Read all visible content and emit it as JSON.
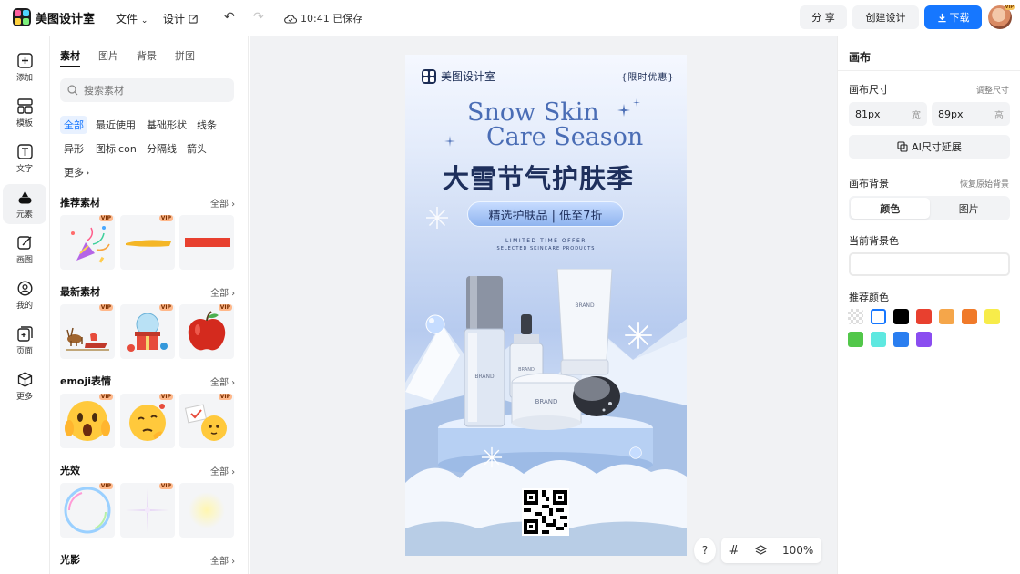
{
  "app": {
    "name": "美图设计室"
  },
  "menu": {
    "file": "文件",
    "design": "设计"
  },
  "save_status": "10:41 已保存",
  "actions": {
    "share": "分 享",
    "create": "创建设计",
    "download": "下载"
  },
  "user": {
    "badge": "VIP"
  },
  "rail": [
    {
      "label": "添加",
      "icon": "plus-square-icon"
    },
    {
      "label": "模板",
      "icon": "template-icon"
    },
    {
      "label": "文字",
      "icon": "text-icon"
    },
    {
      "label": "元素",
      "icon": "shapes-icon",
      "active": true
    },
    {
      "label": "画图",
      "icon": "pen-icon"
    },
    {
      "label": "我的",
      "icon": "user-icon"
    },
    {
      "label": "页面",
      "icon": "page-add-icon"
    },
    {
      "label": "更多",
      "icon": "cube-icon"
    }
  ],
  "assets": {
    "tabs": [
      "素材",
      "图片",
      "背景",
      "拼图"
    ],
    "search_placeholder": "搜索素材",
    "chips": [
      "全部",
      "最近使用",
      "基础形状",
      "线条",
      "异形",
      "图标icon",
      "分隔线",
      "箭头",
      "更多"
    ],
    "see_all": "全部",
    "sections": [
      {
        "title": "推荐素材",
        "items": [
          {
            "vip": true
          },
          {
            "vip": true
          },
          {
            "vip": false
          }
        ]
      },
      {
        "title": "最新素材",
        "items": [
          {
            "vip": true
          },
          {
            "vip": true
          },
          {
            "vip": true
          }
        ]
      },
      {
        "title": "emoji表情",
        "items": [
          {
            "vip": true
          },
          {
            "vip": true
          },
          {
            "vip": true
          }
        ]
      },
      {
        "title": "光效",
        "items": [
          {
            "vip": true
          },
          {
            "vip": true
          },
          {
            "vip": false
          }
        ]
      },
      {
        "title": "光影",
        "items": []
      }
    ],
    "vip_label": "VIP"
  },
  "poster": {
    "brand": "美图设计室",
    "badge": "{限时优惠}",
    "title_en_1": "Snow Skin",
    "title_en_2": "Care Season",
    "title_cn": "大雪节气护肤季",
    "promo": "精选护肤品 | 低至7折",
    "sub_1": "LIMITED TIME OFFER",
    "sub_2": "SELECTED SKINCARE PRODUCTS",
    "product_label": "BRAND"
  },
  "floatbar": {
    "help": "?",
    "zoom": "100%"
  },
  "inspector": {
    "title": "画布",
    "size_label": "画布尺寸",
    "size_link": "调整尺寸",
    "width": "81px",
    "width_unit": "宽",
    "height": "89px",
    "height_unit": "高",
    "ai_button": "AI尺寸延展",
    "bg_label": "画布背景",
    "bg_link": "恢复原始背景",
    "bg_tabs": [
      "颜色",
      "图片"
    ],
    "current_bg_label": "当前背景色",
    "recommended_label": "推荐颜色",
    "swatches": [
      "transparent",
      "#ffffff",
      "#000000",
      "#e8402f",
      "#f5a64a",
      "#f07a2a",
      "#f7ec4a",
      "#52c74a",
      "#5ee8e0",
      "#2a7ef0",
      "#8a4df0"
    ]
  }
}
